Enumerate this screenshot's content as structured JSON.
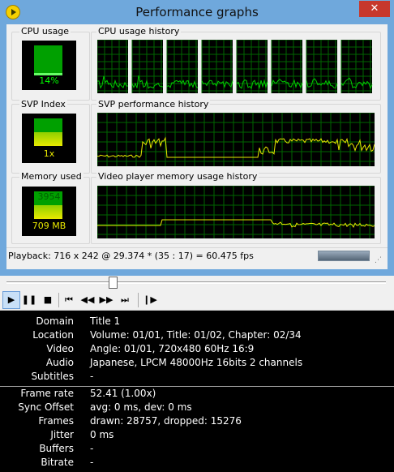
{
  "window": {
    "title": "Performance graphs",
    "close_label": "✕"
  },
  "groups": {
    "cpu_usage": {
      "label": "CPU usage",
      "value": "14%",
      "level": 0.14
    },
    "cpu_history": {
      "label": "CPU usage history"
    },
    "svp_index": {
      "label": "SVP Index",
      "value": "1x",
      "level": 0.45
    },
    "svp_history": {
      "label": "SVP performance history"
    },
    "memory": {
      "label": "Memory used",
      "value": "709 MB",
      "level": 0.5,
      "top_value": "3954"
    },
    "memory_history": {
      "label": "Video player memory usage history"
    }
  },
  "status": {
    "playback": "Playback: 716 x 242 @ 29.374 * (35 : 17) = 60.475 fps"
  },
  "colors": {
    "graph_line": "#e8e800",
    "cpu_line": "#00cc00",
    "grid": "#006600",
    "meter_green": "#00b000",
    "meter_yellow": "#e8e800"
  },
  "player": {
    "seek_position": 0.27,
    "buttons": [
      "play-icon",
      "pause-icon",
      "stop-icon",
      "skip-back-icon",
      "rewind-icon",
      "fast-forward-icon",
      "skip-forward-icon",
      "frame-step-icon"
    ]
  },
  "info": [
    {
      "label": "Domain",
      "value": "Title 1"
    },
    {
      "label": "Location",
      "value": "Volume: 01/01, Title: 01/02, Chapter: 02/34"
    },
    {
      "label": "Video",
      "value": "Angle: 01/01, 720x480 60Hz 16:9"
    },
    {
      "label": "Audio",
      "value": "Japanese, LPCM 48000Hz 16bits 2 channels"
    },
    {
      "label": "Subtitles",
      "value": "-"
    }
  ],
  "stats": [
    {
      "label": "Frame rate",
      "value": "52.41 (1.00x)"
    },
    {
      "label": "Sync Offset",
      "value": "avg: 0 ms, dev: 0 ms"
    },
    {
      "label": "Frames",
      "value": "drawn: 28757, dropped: 15276"
    },
    {
      "label": "Jitter",
      "value": "0 ms"
    },
    {
      "label": "Buffers",
      "value": "-"
    },
    {
      "label": "Bitrate",
      "value": "-"
    }
  ]
}
